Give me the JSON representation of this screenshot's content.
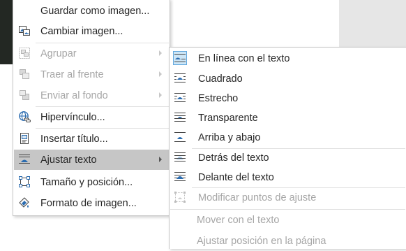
{
  "main_menu": {
    "items": [
      {
        "label": "Guardar como imagen...",
        "icon": "save-picture-icon",
        "state": "normal",
        "submenu": false
      },
      {
        "label": "Cambiar imagen...",
        "icon": "change-picture-icon",
        "state": "normal",
        "submenu": false
      },
      {
        "label": "Agrupar",
        "icon": "group-icon",
        "state": "disabled",
        "submenu": true
      },
      {
        "label": "Traer al frente",
        "icon": "bring-to-front-icon",
        "state": "disabled",
        "submenu": true
      },
      {
        "label": "Enviar al fondo",
        "icon": "send-to-back-icon",
        "state": "disabled",
        "submenu": true
      },
      {
        "label": "Hipervínculo...",
        "icon": "hyperlink-icon",
        "state": "normal",
        "submenu": false
      },
      {
        "label": "Insertar título...",
        "icon": "insert-caption-icon",
        "state": "normal",
        "submenu": false
      },
      {
        "label": "Ajustar texto",
        "icon": "wrap-text-icon",
        "state": "hover",
        "submenu": true
      },
      {
        "label": "Tamaño y posición...",
        "icon": "size-position-icon",
        "state": "normal",
        "submenu": false
      },
      {
        "label": "Formato de imagen...",
        "icon": "format-picture-icon",
        "state": "normal",
        "submenu": false
      }
    ]
  },
  "wrap_submenu": {
    "items": [
      {
        "label": "En línea con el texto",
        "icon": "inline-with-text-icon",
        "state": "selected"
      },
      {
        "label": "Cuadrado",
        "icon": "square-wrap-icon",
        "state": "normal"
      },
      {
        "label": "Estrecho",
        "icon": "tight-wrap-icon",
        "state": "normal"
      },
      {
        "label": "Transparente",
        "icon": "through-wrap-icon",
        "state": "normal"
      },
      {
        "label": "Arriba y abajo",
        "icon": "top-bottom-wrap-icon",
        "state": "normal"
      },
      {
        "label": "Detrás del texto",
        "icon": "behind-text-icon",
        "state": "normal"
      },
      {
        "label": "Delante del texto",
        "icon": "in-front-of-text-icon",
        "state": "normal"
      },
      {
        "label": "Modificar puntos de ajuste",
        "icon": "edit-wrap-points-icon",
        "state": "disabled"
      },
      {
        "label": "Mover con el texto",
        "icon": "",
        "state": "disabled"
      },
      {
        "label": "Ajustar posición en la página",
        "icon": "",
        "state": "disabled"
      }
    ]
  },
  "colors": {
    "hover_bg": "#c6c6c6",
    "selected_bg": "#cde6f7",
    "selected_border": "#62a8de",
    "icon_blue": "#2b6cb0",
    "disabled_text": "#a6a6a6"
  }
}
